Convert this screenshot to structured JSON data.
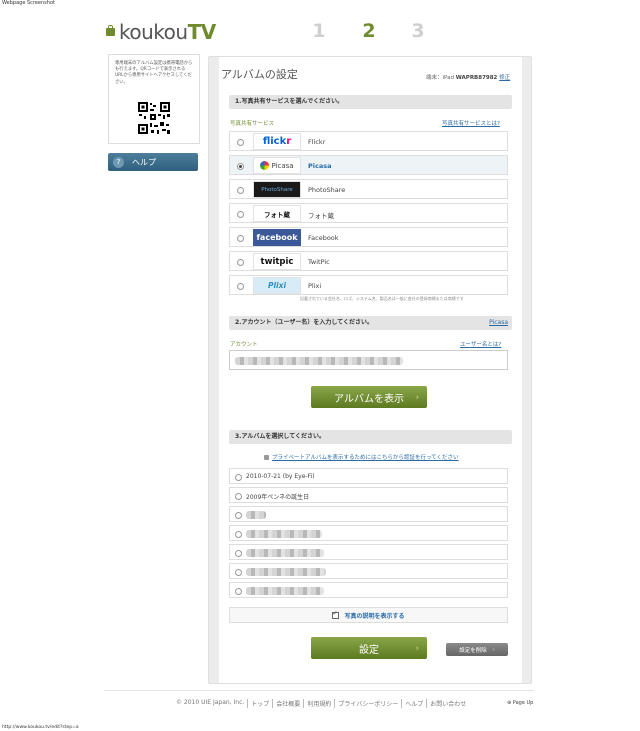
{
  "page": {
    "caption_top": "Webpage Screenshot",
    "caption_bottom": "http://www.koukou.tv/edit?step=a"
  },
  "brand": {
    "logo_prefix": "koukou",
    "logo_suffix": "TV",
    "accent": "#6f8b2e"
  },
  "steps": [
    {
      "label": "1",
      "active": false
    },
    {
      "label": "2",
      "active": true
    },
    {
      "label": "3",
      "active": false
    }
  ],
  "sidebar": {
    "qr_text": "専用端末のアルバム設定は携帯電話からも行えます。QRコードで表示されるURLから専用サイトへアクセスしてください。",
    "help_label": "ヘルプ"
  },
  "main": {
    "title": "アルバムの設定",
    "device_prefix": "端末：iPad",
    "device_id": "WAPRB87982",
    "device_edit": "修正",
    "section1": {
      "title": "1.写真共有サービスを選んでください。",
      "label": "写真共有サービス",
      "help_link": "写真共有サービスとは?",
      "services": [
        {
          "name": "Flickr",
          "logo": "flickr",
          "selected": false
        },
        {
          "name": "Picasa",
          "logo": "Picasa",
          "selected": true
        },
        {
          "name": "PhotoShare",
          "logo": "PhotoShare",
          "selected": false
        },
        {
          "name": "フォト蔵",
          "logo": "フォト蔵",
          "selected": false
        },
        {
          "name": "Facebook",
          "logo": "facebook",
          "selected": false
        },
        {
          "name": "TwitPic",
          "logo": "twitpic",
          "selected": false
        },
        {
          "name": "Plixi",
          "logo": "Plixi",
          "selected": false
        }
      ],
      "disclaimer": "記載されている会社名、ロゴ、システム名、製品名は一般に各社の登録商標または商標です"
    },
    "section2": {
      "title": "2.アカウント（ユーザー名）を入力してください。",
      "service_tag": "Picasa",
      "label": "アカウント",
      "help_link": "ユーザー名とは?",
      "button": "アルバムを表示"
    },
    "section3": {
      "title": "3.アルバムを選択してください。",
      "private_link": "プライベートアルバムを表示するためにはこちらから認証を行ってください",
      "albums": [
        {
          "name": "2010-07-21 (by Eye-Fi)"
        },
        {
          "name": "2009年ペンネの誕生日"
        },
        {
          "name": ""
        },
        {
          "name": ""
        },
        {
          "name": ""
        },
        {
          "name": ""
        },
        {
          "name": ""
        }
      ],
      "show_description": "写真の説明を表示する",
      "submit": "設定",
      "delete": "設定を削除"
    }
  },
  "footer": {
    "copyright": "© 2010 UIE Japan, Inc.",
    "links": [
      "トップ",
      "会社概要",
      "利用規約",
      "プライバシーポリシー",
      "ヘルプ",
      "お問い合わせ"
    ],
    "pageup": "Page Up"
  }
}
